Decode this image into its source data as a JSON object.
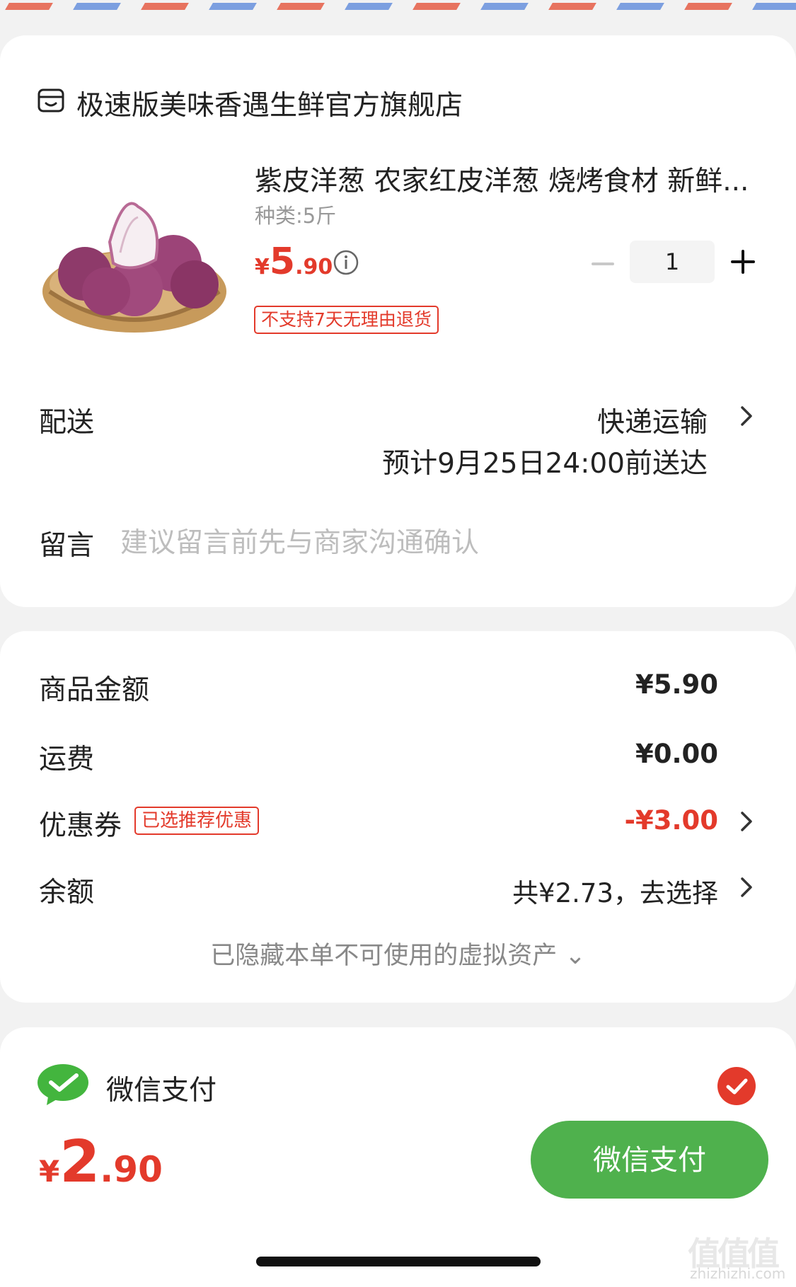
{
  "shop": {
    "name": "极速版美味香遇生鲜官方旗舰店",
    "icon": "store-icon"
  },
  "product": {
    "title": "紫皮洋葱 农家红皮洋葱 烧烤食材 新鲜...",
    "spec": "种类:5斤",
    "price_symbol": "¥",
    "price_int": "5",
    "price_dec": ".90",
    "quantity": "1",
    "no_return_badge": "不支持7天无理由退货",
    "image": "onion-basket-image"
  },
  "delivery": {
    "label": "配送",
    "method": "快递运输",
    "eta": "预计9月25日24:00前送达"
  },
  "message": {
    "label": "留言",
    "placeholder": "建议留言前先与商家沟通确认"
  },
  "summary": {
    "goods_label": "商品金额",
    "goods_value": "¥5.90",
    "shipping_label": "运费",
    "shipping_value": "¥0.00",
    "coupon_label": "优惠券",
    "coupon_badge": "已选推荐优惠",
    "coupon_value": "-¥3.00",
    "balance_label": "余额",
    "balance_value": "共¥2.73，去选择",
    "hidden_assets": "已隐藏本单不可使用的虚拟资产 ⌄"
  },
  "payment": {
    "method_label": "微信支付",
    "total_symbol": "¥",
    "total_int": "2",
    "total_dec": ".90",
    "pay_button": "微信支付"
  },
  "watermark": {
    "main": "值值值",
    "sub": "zhizhizhi.com"
  },
  "colors": {
    "accent_red": "#e33a2b",
    "wechat_green": "#4fb14d"
  }
}
